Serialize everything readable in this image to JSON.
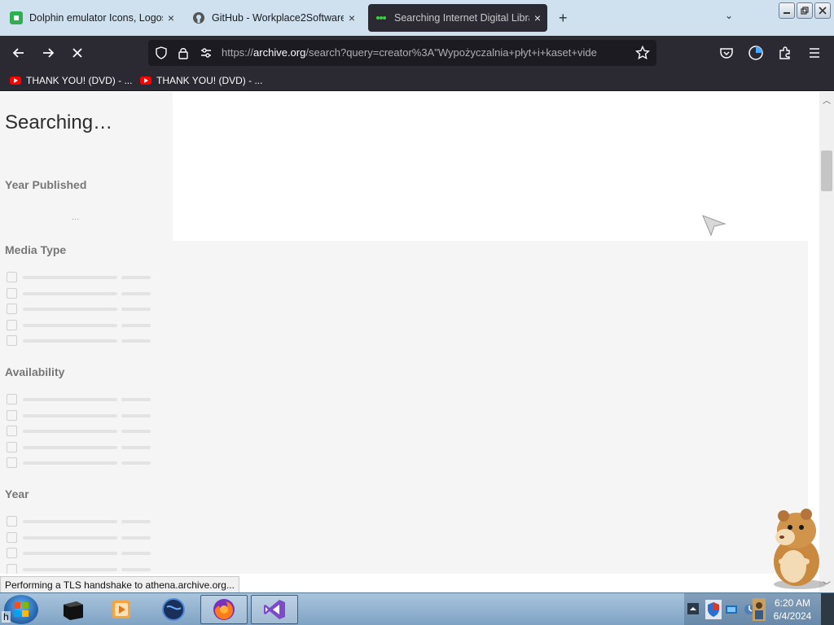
{
  "browser": {
    "tabs": [
      {
        "label": "Dolphin emulator Icons, Logos,",
        "icon": "green-document-icon",
        "close": "×"
      },
      {
        "label": "GitHub - Workplace2Software/",
        "icon": "github-icon",
        "close": "×"
      },
      {
        "label": "Searching Internet Digital Library",
        "icon": "loading-icon",
        "close": "×",
        "active": true
      }
    ],
    "new_tab": "+",
    "url": {
      "prefix": "https://",
      "host": "archive.org",
      "rest": "/search?query=creator%3A\"Wypożyczalnia+płyt+i+kaset+vide"
    },
    "bookmarks": [
      {
        "label": "THANK YOU! (DVD) - ...",
        "icon": "youtube-icon"
      },
      {
        "label": "THANK YOU! (DVD) - ...",
        "icon": "youtube-icon"
      }
    ]
  },
  "page": {
    "heading": "Searching…",
    "facets": {
      "year_published": "Year Published",
      "year_published_placeholder": "...",
      "media_type": "Media Type",
      "availability": "Availability",
      "year": "Year"
    }
  },
  "status_bar": "Performing a TLS handshake to athena.archive.org...",
  "taskbar": {
    "start_label": "h",
    "time": "6:20 AM",
    "date": "6/4/2024"
  },
  "colors": {
    "tab_strip": "#cfe0ef",
    "toolbar": "#2b2a33",
    "url_field": "#1c1b22",
    "sidebar_bg": "#f5f5f5",
    "taskbar": "#8fb0cf"
  }
}
